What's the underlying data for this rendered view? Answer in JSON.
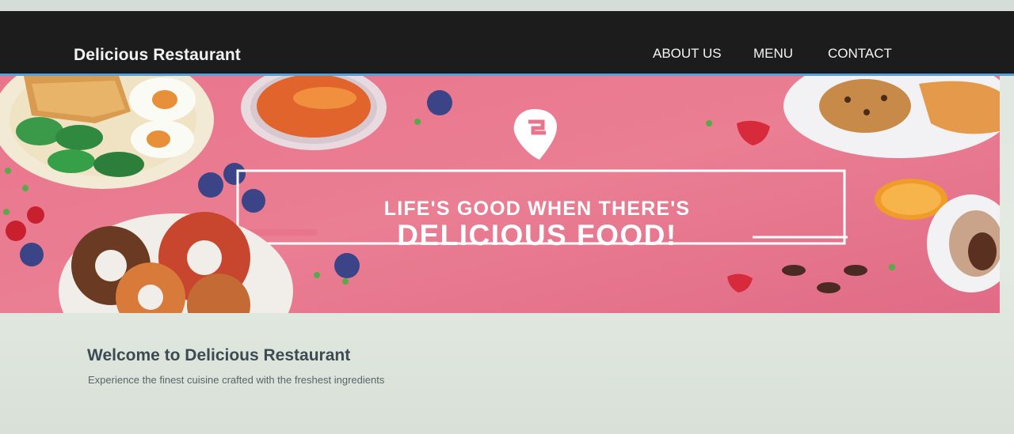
{
  "header": {
    "brand": "Delicious Restaurant",
    "nav": {
      "about": "ABOUT US",
      "menu": "MENU",
      "contact": "CONTACT"
    }
  },
  "hero": {
    "headline_line1": "LIFE'S GOOD WHEN THERE'S",
    "headline_line2": "DELICIOUS FOOD!",
    "logo_icon": "swiggy-logo-icon",
    "background_color": "#e8768f"
  },
  "main": {
    "title": "Welcome to Delicious Restaurant",
    "subtitle": "Experience the finest cuisine crafted with the freshest ingredients"
  },
  "colors": {
    "navbar": "#1c1c1c",
    "nav_border": "#5aa0d8",
    "page_bg": "#e1e8e0"
  }
}
